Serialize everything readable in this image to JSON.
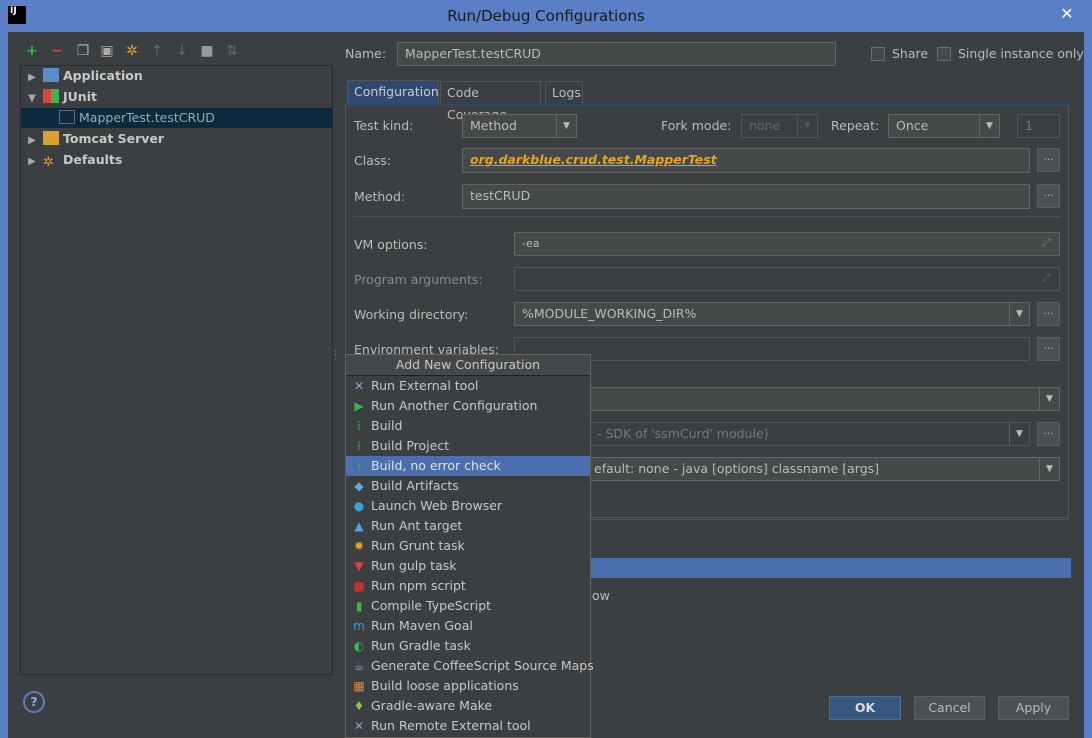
{
  "window": {
    "title": "Run/Debug Configurations",
    "logo": "IJ",
    "close": "✕"
  },
  "toolbar": {
    "icons": [
      "plus-icon",
      "minus-icon",
      "copy-icon",
      "save-icon",
      "wrench-icon",
      "arrow-up-icon",
      "arrow-down-icon",
      "folder-icon",
      "sort-icon"
    ]
  },
  "tree": {
    "items": [
      {
        "label": "Application",
        "expanded": false
      },
      {
        "label": "JUnit",
        "expanded": true
      },
      {
        "label": "MapperTest.testCRUD",
        "selected": true
      },
      {
        "label": "Tomcat Server",
        "expanded": false
      },
      {
        "label": "Defaults",
        "expanded": false
      }
    ]
  },
  "name": {
    "label": "Name:",
    "value": "MapperTest.testCRUD"
  },
  "share": {
    "label": "Share",
    "checked": false
  },
  "single": {
    "label": "Single instance only",
    "checked": false
  },
  "tabs": [
    {
      "label": "Configuration",
      "active": true
    },
    {
      "label": "Code Coverage"
    },
    {
      "label": "Logs"
    }
  ],
  "config": {
    "test_kind": {
      "label": "Test kind:",
      "value": "Method"
    },
    "fork_mode": {
      "label": "Fork mode:",
      "value": "none"
    },
    "repeat": {
      "label": "Repeat:",
      "value": "Once",
      "count": "1"
    },
    "class": {
      "label": "Class:",
      "value": "org.darkblue.crud.test.MapperTest"
    },
    "method": {
      "label": "Method:",
      "value": "testCRUD"
    },
    "vm_options": {
      "label": "VM options:",
      "value": "-ea"
    },
    "program_args": {
      "label": "Program arguments:",
      "value": ""
    },
    "working_dir": {
      "label": "Working directory:",
      "value": "%MODULE_WORKING_DIR%"
    },
    "env_vars": {
      "label": "Environment variables:",
      "value": ""
    },
    "jre_partial": "- SDK of 'ssmCurd' module)",
    "shorten_partial": "efault: none - java [options] classname [args]",
    "partial_text": "ow"
  },
  "popup": {
    "title": "Add New Configuration",
    "items": [
      {
        "label": "Run External tool",
        "icon": "wrench-icon",
        "glyph": "✕",
        "color": "#8aa4c8"
      },
      {
        "label": "Run Another Configuration",
        "icon": "play-icon",
        "glyph": "▶",
        "color": "#3fb34f"
      },
      {
        "label": "Build",
        "icon": "build-icon",
        "glyph": "⁞",
        "color": "#3fb34f"
      },
      {
        "label": "Build Project",
        "icon": "build-project-icon",
        "glyph": "⁞",
        "color": "#3fb34f"
      },
      {
        "label": "Build, no error check",
        "icon": "build-icon",
        "glyph": "⁞",
        "color": "#3fb34f",
        "highlighted": true
      },
      {
        "label": "Build Artifacts",
        "icon": "artifacts-icon",
        "glyph": "◆",
        "color": "#6fa7d8"
      },
      {
        "label": "Launch Web Browser",
        "icon": "globe-icon",
        "glyph": "●",
        "color": "#3d9fd8"
      },
      {
        "label": "Run Ant target",
        "icon": "ant-icon",
        "glyph": "▲",
        "color": "#5a9fd8"
      },
      {
        "label": "Run Grunt task",
        "icon": "grunt-icon",
        "glyph": "✹",
        "color": "#e8a317"
      },
      {
        "label": "Run gulp task",
        "icon": "gulp-icon",
        "glyph": "▼",
        "color": "#d9443c"
      },
      {
        "label": "Run npm script",
        "icon": "npm-icon",
        "glyph": "■",
        "color": "#c9302c"
      },
      {
        "label": "Compile TypeScript",
        "icon": "typescript-icon",
        "glyph": "▮",
        "color": "#3fb34f"
      },
      {
        "label": "Run Maven Goal",
        "icon": "maven-icon",
        "glyph": "m",
        "color": "#3d9fd8"
      },
      {
        "label": "Run Gradle task",
        "icon": "gradle-icon",
        "glyph": "◐",
        "color": "#3fb34f"
      },
      {
        "label": "Generate CoffeeScript Source Maps",
        "icon": "coffee-icon",
        "glyph": "☕",
        "color": "#6fa7d8"
      },
      {
        "label": "Build loose applications",
        "icon": "loose-app-icon",
        "glyph": "▦",
        "color": "#d88a3d"
      },
      {
        "label": "Gradle-aware Make",
        "icon": "android-icon",
        "glyph": "♦",
        "color": "#8bc34a"
      },
      {
        "label": "Run Remote External tool",
        "icon": "wrench-icon",
        "glyph": "✕",
        "color": "#8aa4c8"
      }
    ]
  },
  "buttons": {
    "help": "?",
    "ok": "OK",
    "cancel": "Cancel",
    "apply": "Apply"
  }
}
